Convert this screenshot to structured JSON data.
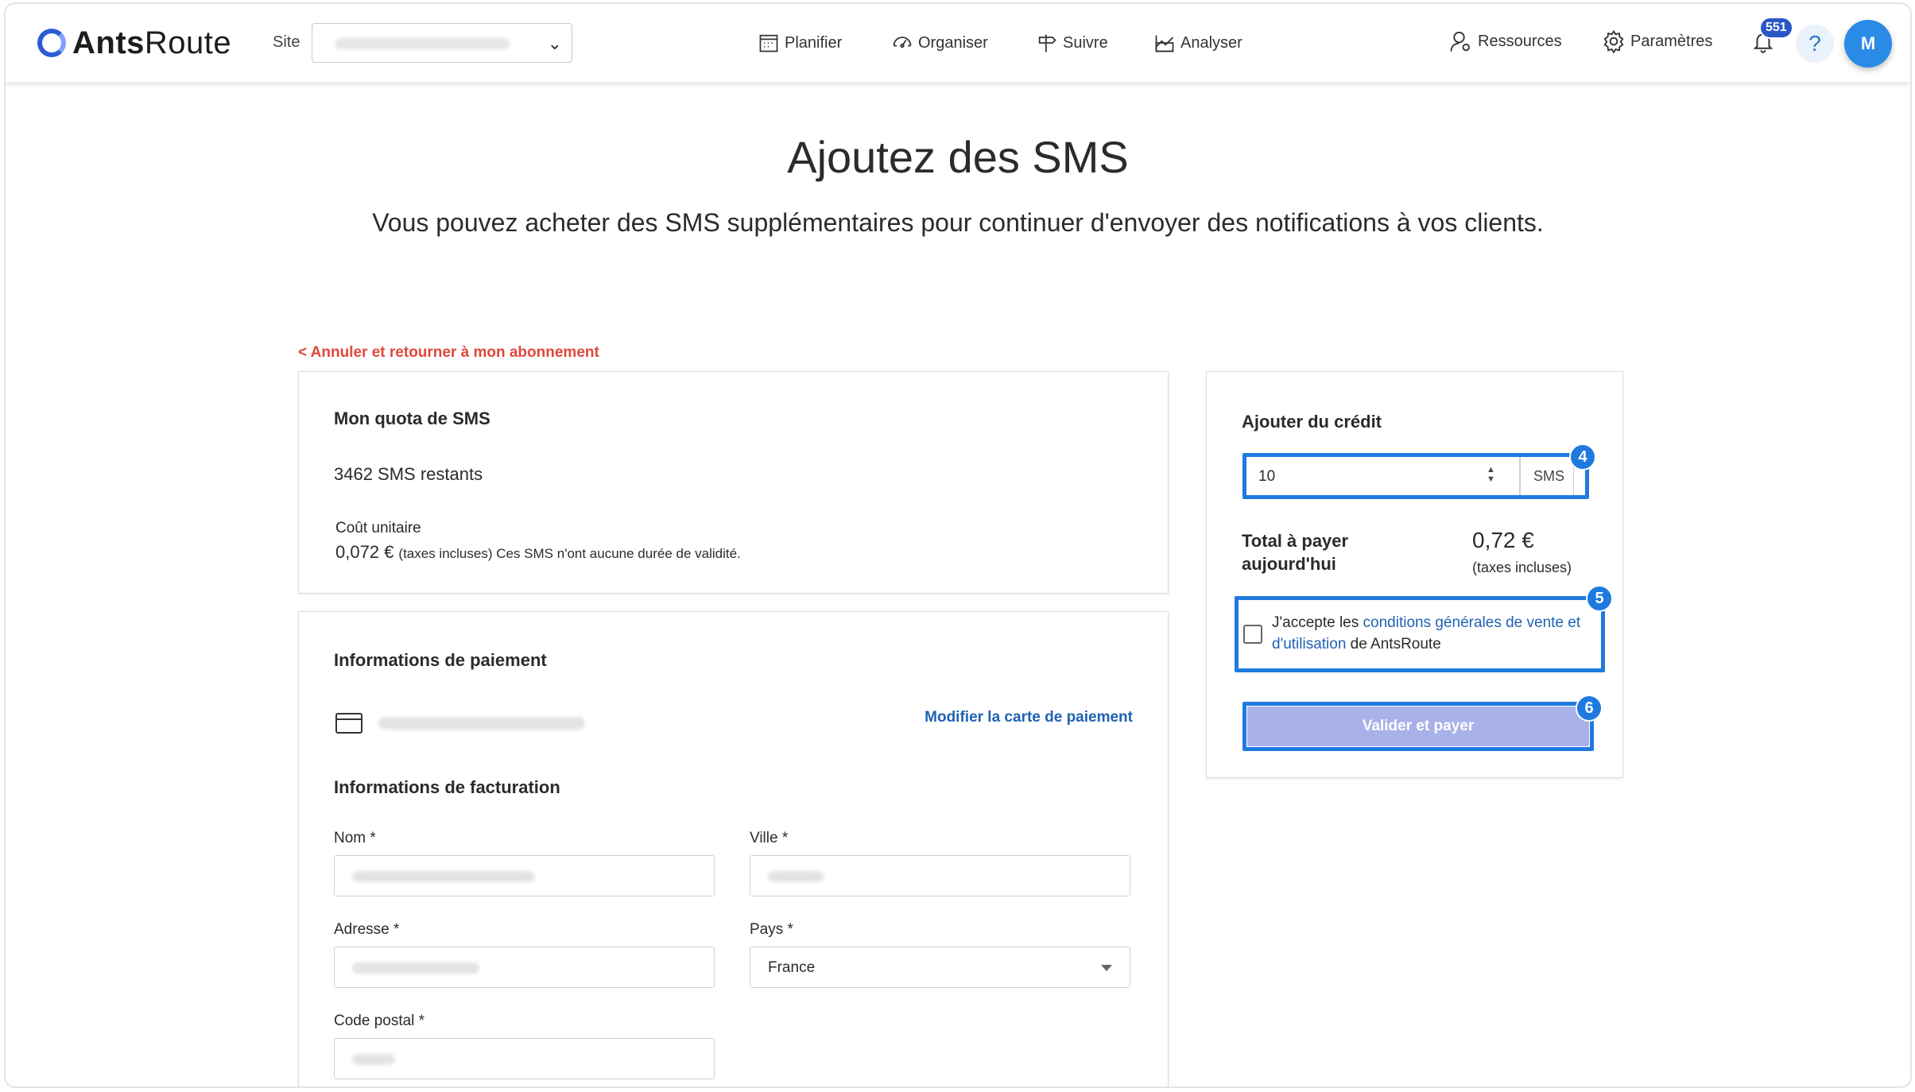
{
  "app": {
    "brand_bold": "Ants",
    "brand_light": "Route"
  },
  "header": {
    "site_label": "Site",
    "nav": [
      {
        "label": "Planifier",
        "icon": "calendar-icon"
      },
      {
        "label": "Organiser",
        "icon": "speedometer-icon"
      },
      {
        "label": "Suivre",
        "icon": "signpost-icon"
      },
      {
        "label": "Analyser",
        "icon": "chart-icon"
      }
    ],
    "resources_label": "Ressources",
    "settings_label": "Paramètres",
    "notifications_count": "551",
    "help_label": "?",
    "avatar_initial": "M"
  },
  "page": {
    "title": "Ajoutez des SMS",
    "subtitle": "Vous pouvez acheter des SMS supplémentaires pour continuer d'envoyer des notifications à vos clients.",
    "back_link": "< Annuler et retourner à mon abonnement"
  },
  "quota": {
    "title": "Mon quota de SMS",
    "remaining": "3462 SMS restants",
    "unit_cost_label": "Coût unitaire",
    "unit_cost_value": "0,072 €",
    "unit_cost_note": "(taxes incluses) Ces SMS n'ont aucune durée de validité."
  },
  "payment": {
    "title": "Informations de paiement",
    "modify_card": "Modifier la carte de paiement",
    "billing_title": "Informations de facturation",
    "fields": {
      "nom_label": "Nom *",
      "ville_label": "Ville *",
      "adresse_label": "Adresse *",
      "pays_label": "Pays *",
      "pays_value": "France",
      "code_postal_label": "Code postal *"
    }
  },
  "credit": {
    "title": "Ajouter du crédit",
    "quantity_value": "10",
    "quantity_unit": "SMS",
    "total_label_1": "Total à payer",
    "total_label_2": "aujourd'hui",
    "total_value": "0,72 €",
    "total_note": "(taxes incluses)",
    "terms_prefix": "J'accepte les ",
    "terms_link": "conditions générales de vente et d'utilisation",
    "terms_suffix": " de AntsRoute",
    "pay_button": "Valider et payer",
    "step_4": "4",
    "step_5": "5",
    "step_6": "6"
  },
  "colors": {
    "accent": "#1f7ae0",
    "danger_link": "#e0473a",
    "button_disabled": "#a8b1e8"
  }
}
